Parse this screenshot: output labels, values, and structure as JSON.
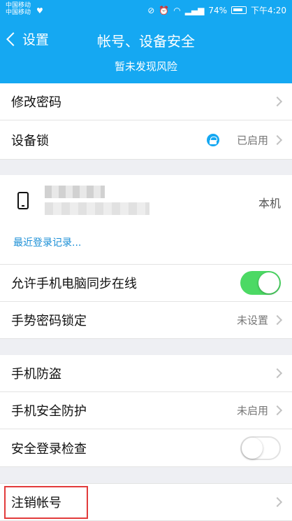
{
  "status_bar": {
    "carrier_1": "中国移动",
    "carrier_2": "中国移动",
    "battery": "74%",
    "time": "下午4:20"
  },
  "header": {
    "back_label": "设置",
    "title": "帐号、设备安全",
    "subtitle": "暂未发现风险"
  },
  "rows": {
    "change_password": {
      "label": "修改密码"
    },
    "device_lock": {
      "label": "设备锁",
      "status": "已启用"
    },
    "sync_online": {
      "label": "允许手机电脑同步在线",
      "enabled": true
    },
    "gesture_lock": {
      "label": "手势密码锁定",
      "status": "未设置"
    },
    "anti_theft": {
      "label": "手机防盗"
    },
    "phone_protect": {
      "label": "手机安全防护",
      "status": "未启用"
    },
    "login_check": {
      "label": "安全登录检查",
      "enabled": false
    },
    "cancel_account": {
      "label": "注销帐号"
    }
  },
  "device": {
    "tag": "本机",
    "recent_login_link": "最近登录记录..."
  },
  "colors": {
    "header_bg": "#15a8f2",
    "toggle_on": "#4cd964",
    "link": "#1b8fd6",
    "highlight_border": "#e23b3b"
  }
}
